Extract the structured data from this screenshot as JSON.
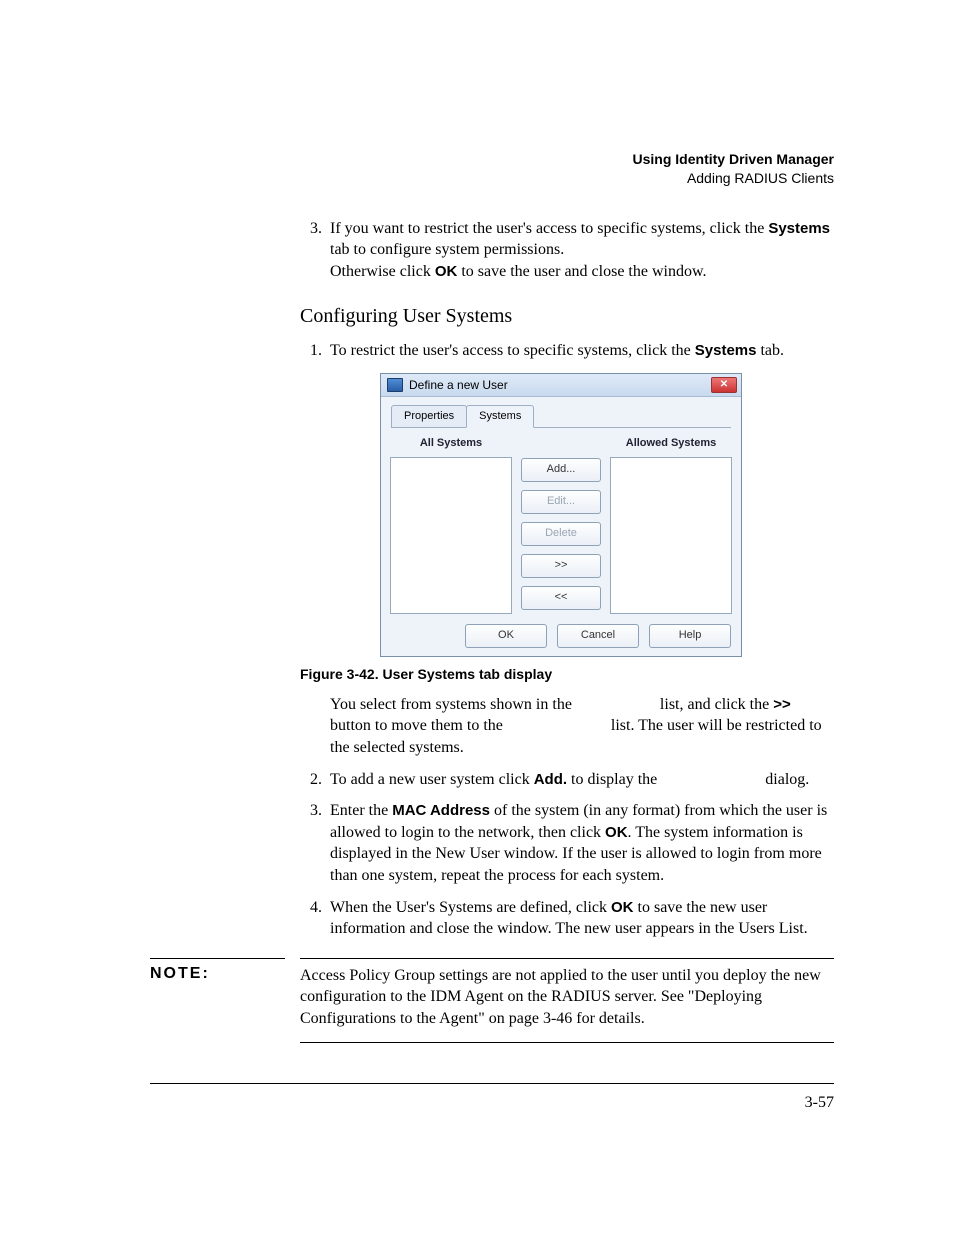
{
  "header": {
    "title": "Using Identity Driven Manager",
    "subtitle": "Adding RADIUS Clients"
  },
  "step3": {
    "num": "3.",
    "t1": "If you want to restrict the user's access to specific systems, click the ",
    "b1": "Systems",
    "t2": " tab to configure system permissions.",
    "t3": "Otherwise click ",
    "b2": "OK",
    "t4": " to save the user and close the window."
  },
  "subheading": "Configuring User Systems",
  "cs1": {
    "num": "1.",
    "t1": "To restrict the user's access to specific systems, click the ",
    "b1": "Systems",
    "t2": " tab."
  },
  "dialog": {
    "title": "Define a new User",
    "tabs": {
      "properties": "Properties",
      "systems": "Systems"
    },
    "labels": {
      "all": "All Systems",
      "allowed": "Allowed Systems"
    },
    "buttons": {
      "add": "Add...",
      "edit": "Edit...",
      "delete": "Delete",
      "moveRight": ">>",
      "moveLeft": "<<",
      "ok": "OK",
      "cancel": "Cancel",
      "help": "Help"
    }
  },
  "caption": "Figure 3-42. User Systems tab display",
  "after1": {
    "t1": "You select from systems shown in the ",
    "t2": " list, and click the ",
    "b1": ">>",
    "t3": " button to move them to the ",
    "t4": " list. The user will be restricted to the selected systems."
  },
  "cs2": {
    "num": "2.",
    "t1": "To add a new user system click ",
    "b1": "Add.",
    "t2": " to display the ",
    "t3": " dialog."
  },
  "cs3": {
    "num": "3.",
    "t1": "Enter the ",
    "b1": "MAC Address",
    "t2": " of the system (in any format) from which the user is allowed to login to the network, then click ",
    "b2": "OK",
    "t3": ". The system information is displayed in the New User window. If the user is allowed to login from more than one system, repeat the process for each system."
  },
  "cs4": {
    "num": "4.",
    "t1": "When the User's Systems are defined, click ",
    "b1": "OK",
    "t2": " to save the new user information and close the window. The new user appears in the Users List."
  },
  "note": {
    "label": "NOTE:",
    "body": "Access Policy Group settings are not applied to the user until you deploy the new configuration to the IDM Agent on the RADIUS server. See \"Deploying Configurations to the Agent\" on page 3-46 for details."
  },
  "pagenum": "3-57"
}
